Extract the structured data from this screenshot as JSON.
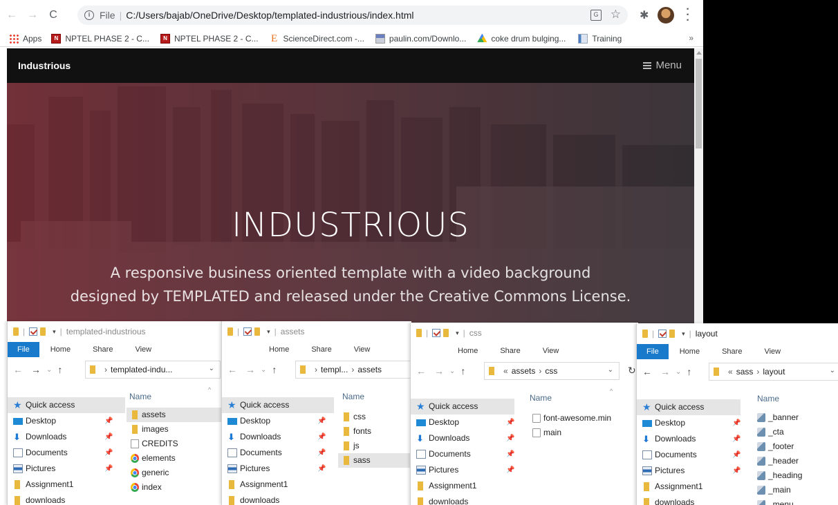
{
  "browser": {
    "url_scheme": "File",
    "url_path": "C:/Users/bajab/OneDrive/Desktop/templated-industrious/index.html",
    "bookmarks": [
      {
        "label": "Apps",
        "icon": "apps-icon"
      },
      {
        "label": "NPTEL PHASE 2 - C...",
        "icon": "nptel-icon"
      },
      {
        "label": "NPTEL PHASE 2 - C...",
        "icon": "nptel-icon"
      },
      {
        "label": "ScienceDirect.com -...",
        "icon": "sciencedirect-icon"
      },
      {
        "label": "paulin.com/Downlo...",
        "icon": "paulin-icon"
      },
      {
        "label": "coke drum bulging...",
        "icon": "google-drive-icon"
      },
      {
        "label": "Training",
        "icon": "document-icon"
      }
    ],
    "bookmarks_more": "»"
  },
  "site": {
    "logo": "Industrious",
    "menu_label": "Menu",
    "banner_title": "INDUSTRIOUS",
    "banner_subtitle_line1": "A responsive business oriented template with a video background",
    "banner_subtitle_line2": "designed by TEMPLATED and released under the Creative Commons License."
  },
  "explorers": [
    {
      "title": "templated-industrious",
      "ribbon": [
        "File",
        "Home",
        "Share",
        "View"
      ],
      "path": "templated-indu...",
      "column": "Name",
      "nav": [
        "Quick access",
        "Desktop",
        "Downloads",
        "Documents",
        "Pictures",
        "Assignment1",
        "downloads"
      ],
      "files": [
        {
          "name": "assets",
          "type": "folder"
        },
        {
          "name": "images",
          "type": "folder"
        },
        {
          "name": "CREDITS",
          "type": "text"
        },
        {
          "name": "elements",
          "type": "chrome"
        },
        {
          "name": "generic",
          "type": "chrome"
        },
        {
          "name": "index",
          "type": "chrome"
        }
      ]
    },
    {
      "title": "assets",
      "ribbon": [
        "Home",
        "Share",
        "View"
      ],
      "path_1": "templ...",
      "path_2": "assets",
      "column": "Name",
      "nav": [
        "Quick access",
        "Desktop",
        "Downloads",
        "Documents",
        "Pictures",
        "Assignment1",
        "downloads"
      ],
      "files": [
        {
          "name": "css",
          "type": "folder"
        },
        {
          "name": "fonts",
          "type": "folder"
        },
        {
          "name": "js",
          "type": "folder"
        },
        {
          "name": "sass",
          "type": "folder"
        }
      ]
    },
    {
      "title": "css",
      "ribbon": [
        "Home",
        "Share",
        "View"
      ],
      "path_prefix": "«",
      "path_1": "assets",
      "path_2": "css",
      "column": "Name",
      "nav": [
        "Quick access",
        "Desktop",
        "Downloads",
        "Documents",
        "Pictures",
        "Assignment1",
        "downloads"
      ],
      "files": [
        {
          "name": "font-awesome.min",
          "type": "css"
        },
        {
          "name": "main",
          "type": "css"
        }
      ]
    },
    {
      "title": "layout",
      "ribbon": [
        "File",
        "Home",
        "Share",
        "View"
      ],
      "path_prefix": "«",
      "path_1": "sass",
      "path_2": "layout",
      "column": "Name",
      "nav": [
        "Quick access",
        "Desktop",
        "Downloads",
        "Documents",
        "Pictures",
        "Assignment1",
        "downloads"
      ],
      "files": [
        {
          "name": "_banner",
          "type": "scss"
        },
        {
          "name": "_cta",
          "type": "scss"
        },
        {
          "name": "_footer",
          "type": "scss"
        },
        {
          "name": "_header",
          "type": "scss"
        },
        {
          "name": "_heading",
          "type": "scss"
        },
        {
          "name": "_main",
          "type": "scss"
        },
        {
          "name": "_menu",
          "type": "scss"
        }
      ]
    }
  ],
  "colors": {
    "file_tab": "#1979ca",
    "banner_red": "#9a2a36",
    "folder": "#e8b93c"
  }
}
